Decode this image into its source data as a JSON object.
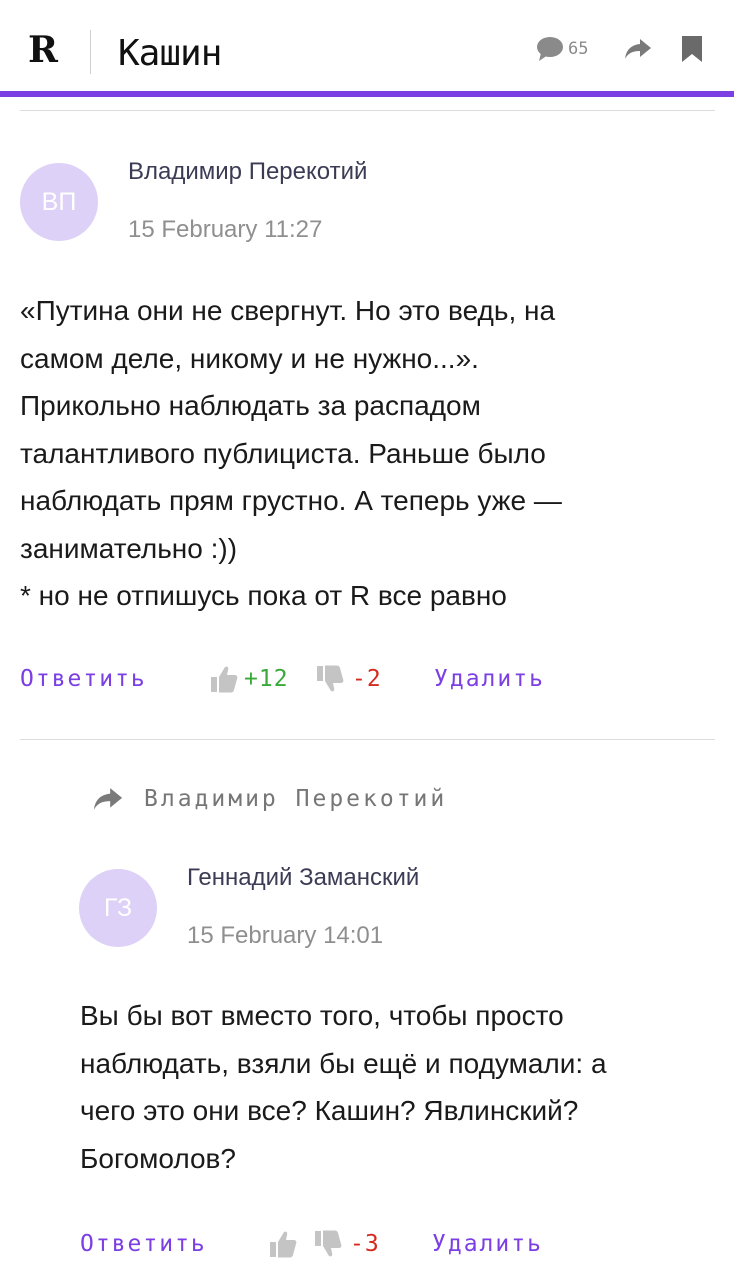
{
  "header": {
    "logo_text": "R",
    "title": "Кашин",
    "comments_count": "65",
    "icons": {
      "comments": "speech-bubble-icon",
      "share": "share-arrow-icon",
      "bookmark": "bookmark-icon"
    },
    "accent_color": "#7b3fe4"
  },
  "comments": [
    {
      "avatar_initials": "ВП",
      "author": "Владимир Перекотий",
      "date": "15 February 11:27",
      "text_lines": [
        "«Путина они не свергнут. Но это ведь, на",
        "самом деле, никому и не нужно...».",
        "Прикольно наблюдать за распадом",
        "талантливого публициста. Раньше было",
        "наблюдать прям грустно. А теперь уже —",
        "занимательно :))",
        "* но не отпишусь пока от R все равно"
      ],
      "reply_label": "Ответить",
      "upvotes": "+12",
      "downvotes": "-2",
      "delete_label": "Удалить"
    },
    {
      "reply_to": "Владимир Перекотий",
      "avatar_initials": "ГЗ",
      "author": "Геннадий Заманский",
      "date": "15 February 14:01",
      "text_lines": [
        "Вы бы вот вместо того, чтобы просто",
        "наблюдать, взяли бы ещё и подумали: а",
        "чего это они все? Кашин? Явлинский?",
        "Богомолов?"
      ],
      "reply_label": "Ответить",
      "downvotes": "-3",
      "delete_label": "Удалить"
    }
  ],
  "colors": {
    "avatar_bg": "#ddd1f7",
    "link": "#7b3fe4",
    "upvote": "#3aa83a",
    "downvote": "#d42a1f"
  }
}
